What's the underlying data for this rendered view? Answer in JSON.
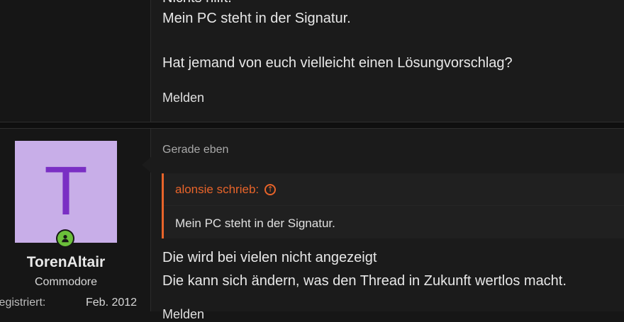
{
  "previous_post": {
    "cut_text": "Nichts hilft.",
    "line1": "Mein PC steht in der Signatur.",
    "line2": "Hat jemand von euch vielleicht einen Lösungvorschlag?",
    "report_label": "Melden"
  },
  "post": {
    "user": {
      "avatar_letter": "T",
      "avatar_bg": "#c8aee8",
      "avatar_fg": "#7a2fc4",
      "online_color": "#6bbf3a",
      "name": "TorenAltair",
      "title": "Commodore",
      "registered_label": "Registriert:",
      "registered_value": "Feb. 2012"
    },
    "date": "Gerade eben",
    "quote": {
      "author": "alonsie schrieb:",
      "jump_icon": "arrow-up-circle-icon",
      "text": "Mein PC steht in der Signatur."
    },
    "body_line1": "Die wird bei vielen nicht angezeigt",
    "body_line2": "Die kann sich ändern, was den Thread in Zukunft wertlos macht.",
    "cut_text_bottom": "Melden"
  },
  "colors": {
    "accent": "#e8642a",
    "background": "#161616",
    "content_bg": "#1b1b1b"
  }
}
